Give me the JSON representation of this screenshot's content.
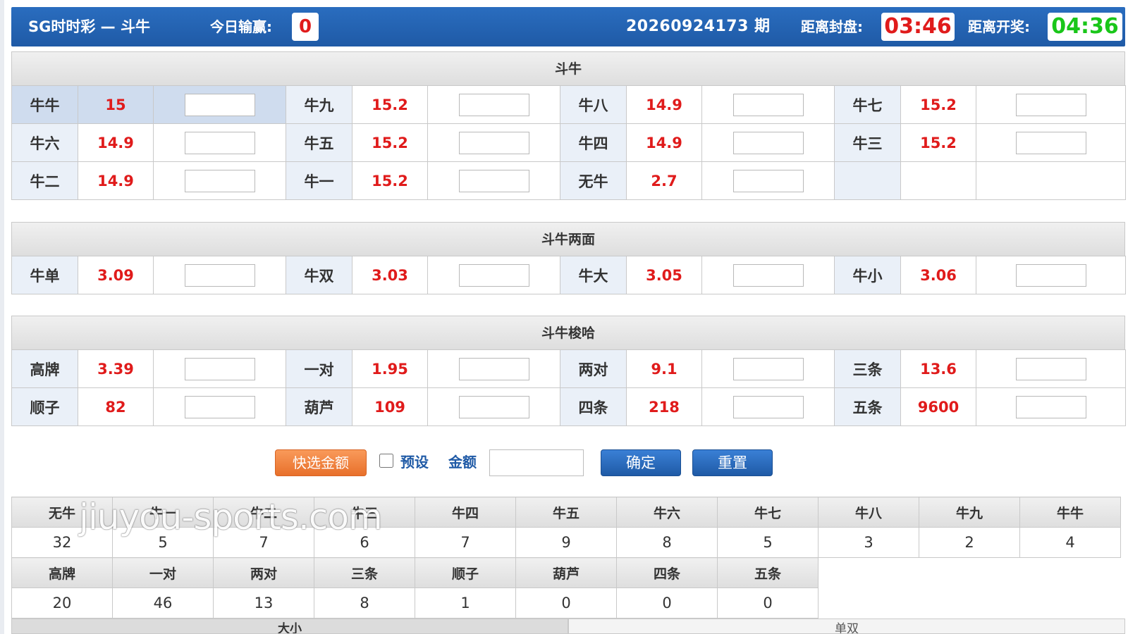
{
  "header": {
    "title": "SG时时彩 — 斗牛",
    "today_label": "今日输赢:",
    "today_value": "0",
    "period": "20260924173 期",
    "close_label": "距离封盘:",
    "close_time": "03:46",
    "open_label": "距离开奖:",
    "open_time": "04:36"
  },
  "section1": {
    "title": "斗牛",
    "rows": [
      [
        {
          "name": "牛牛",
          "odds": "15"
        },
        {
          "name": "牛九",
          "odds": "15.2"
        },
        {
          "name": "牛八",
          "odds": "14.9"
        },
        {
          "name": "牛七",
          "odds": "15.2"
        }
      ],
      [
        {
          "name": "牛六",
          "odds": "14.9"
        },
        {
          "name": "牛五",
          "odds": "15.2"
        },
        {
          "name": "牛四",
          "odds": "14.9"
        },
        {
          "name": "牛三",
          "odds": "15.2"
        }
      ],
      [
        {
          "name": "牛二",
          "odds": "14.9"
        },
        {
          "name": "牛一",
          "odds": "15.2"
        },
        {
          "name": "无牛",
          "odds": "2.7"
        }
      ]
    ]
  },
  "section2": {
    "title": "斗牛两面",
    "rows": [
      [
        {
          "name": "牛单",
          "odds": "3.09"
        },
        {
          "name": "牛双",
          "odds": "3.03"
        },
        {
          "name": "牛大",
          "odds": "3.05"
        },
        {
          "name": "牛小",
          "odds": "3.06"
        }
      ]
    ]
  },
  "section3": {
    "title": "斗牛梭哈",
    "rows": [
      [
        {
          "name": "高牌",
          "odds": "3.39"
        },
        {
          "name": "一对",
          "odds": "1.95"
        },
        {
          "name": "两对",
          "odds": "9.1"
        },
        {
          "name": "三条",
          "odds": "13.6"
        }
      ],
      [
        {
          "name": "顺子",
          "odds": "82"
        },
        {
          "name": "葫芦",
          "odds": "109"
        },
        {
          "name": "四条",
          "odds": "218"
        },
        {
          "name": "五条",
          "odds": "9600"
        }
      ]
    ]
  },
  "controls": {
    "quick_amount": "快选金额",
    "preset_label": "预设",
    "amount_label": "金额",
    "confirm": "确定",
    "reset": "重置"
  },
  "stats1": {
    "headers": [
      "无牛",
      "牛一",
      "牛二",
      "牛三",
      "牛四",
      "牛五",
      "牛六",
      "牛七",
      "牛八",
      "牛九",
      "牛牛"
    ],
    "values": [
      "32",
      "5",
      "7",
      "6",
      "7",
      "9",
      "8",
      "5",
      "3",
      "2",
      "4"
    ]
  },
  "stats2": {
    "headers": [
      "高牌",
      "一对",
      "两对",
      "三条",
      "顺子",
      "葫芦",
      "四条",
      "五条"
    ],
    "values": [
      "20",
      "46",
      "13",
      "8",
      "1",
      "0",
      "0",
      "0"
    ]
  },
  "bottom": {
    "left_title": "大小",
    "right_title": "单双"
  },
  "watermark": "jiuyou-sports.com",
  "colors": {
    "header_blue": "#1f5aa6",
    "odds_red": "#e01b1b",
    "open_green": "#19c619",
    "quick_orange": "#e8702b"
  }
}
